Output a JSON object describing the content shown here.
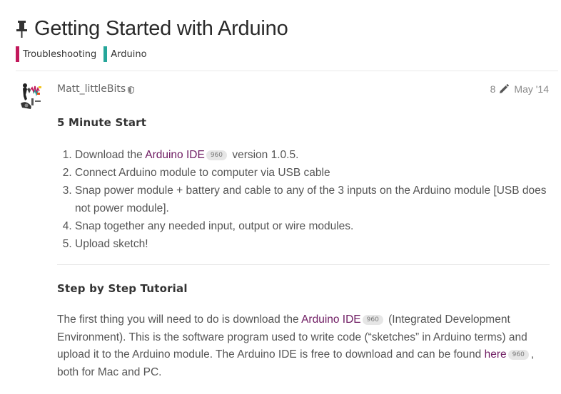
{
  "topic": {
    "title": "Getting Started with Arduino",
    "pin_icon": "pin-icon",
    "categories": [
      {
        "label": "Troubleshooting",
        "color": "#c2185b"
      },
      {
        "label": "Arduino",
        "color": "#26a69a"
      }
    ]
  },
  "post": {
    "username": "Matt_littleBits",
    "edit_count": "8",
    "date": "May '14",
    "sections": {
      "five_minute_title": "5 Minute Start",
      "steps": {
        "s1_pre": "Download the ",
        "s1_link": "Arduino IDE",
        "s1_badge": "960",
        "s1_post": " version 1.0.5.",
        "s2": "Connect Arduino module to computer via USB cable",
        "s3": "Snap power module + battery and cable to any of the 3 inputs on the Arduino module [USB does not power module].",
        "s4": "Snap together any needed input, output or wire modules.",
        "s5": "Upload sketch!"
      },
      "tutorial_title": "Step by Step Tutorial",
      "paragraph": {
        "part1": "The first thing you will need to do is download the ",
        "link1": "Arduino IDE",
        "badge1": "960",
        "part2": " (Integrated Development Environment). This is the software program used to write code (“sketches” in Arduino terms) and upload it to the Arduino module. The Arduino IDE is free to download and can be found ",
        "link2": "here",
        "badge2": "960",
        "part3": ", both for Mac and PC."
      }
    }
  },
  "colors": {
    "link": "#6e1b62",
    "title": "#2a2a2a"
  }
}
